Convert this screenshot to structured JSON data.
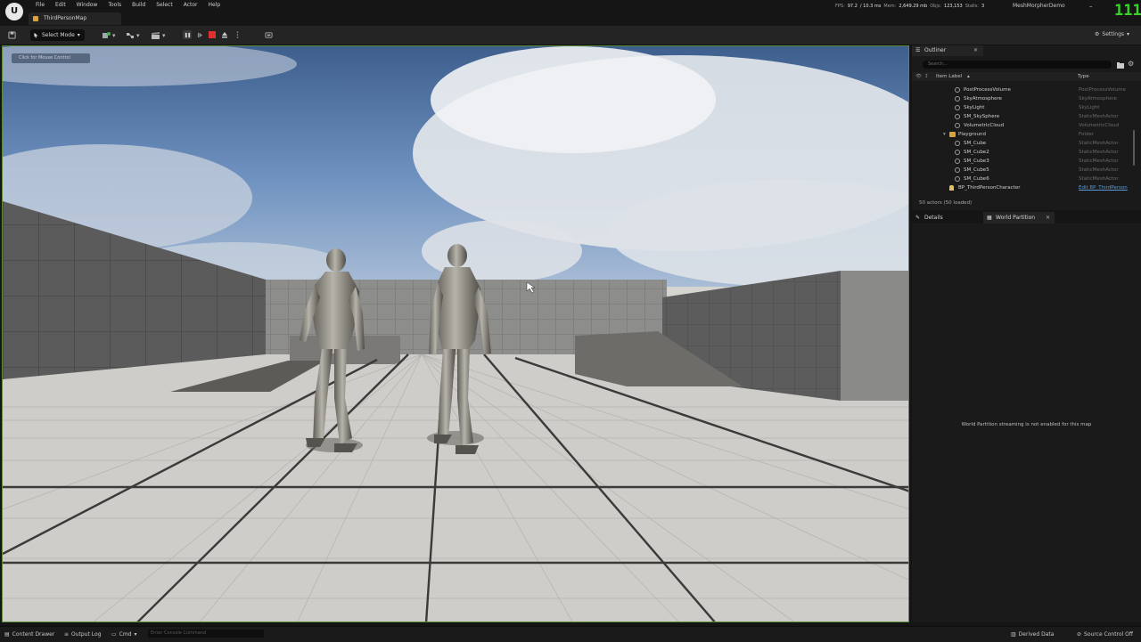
{
  "app": {
    "menu": [
      "File",
      "Edit",
      "Window",
      "Tools",
      "Build",
      "Select",
      "Actor",
      "Help"
    ],
    "map_tab": "ThirdPersonMap",
    "project_name": "MeshMorpherDemo",
    "stats": {
      "fps_label": "FPS:",
      "fps_value": "97.2",
      "frame_ms": "/ 10.3 ms",
      "mem_label": "Mem:",
      "mem_value": "2,649.29 mb",
      "objs_label": "Objs:",
      "objs_value": "123,153",
      "stalls_label": "Stalls:",
      "stalls_value": "3"
    },
    "fps_overlay": "111"
  },
  "toolbar": {
    "select_mode": "Select Mode",
    "settings": "Settings"
  },
  "viewport": {
    "mouse_control_hint": "Click for Mouse Control"
  },
  "outliner": {
    "tab": "Outliner",
    "search_placeholder": "Search...",
    "col_label": "Item Label",
    "col_type": "Type",
    "rows": [
      {
        "label": "PostProcessVolume",
        "type": "PostProcessVolume"
      },
      {
        "label": "SkyAtmosphere",
        "type": "SkyAtmosphere"
      },
      {
        "label": "SkyLight",
        "type": "SkyLight"
      },
      {
        "label": "SM_SkySphere",
        "type": "StaticMeshActor"
      },
      {
        "label": "VolumetricCloud",
        "type": "VolumetricCloud"
      },
      {
        "label": "Playground",
        "type": "Folder"
      },
      {
        "label": "SM_Cube",
        "type": "StaticMeshActor"
      },
      {
        "label": "SM_Cube2",
        "type": "StaticMeshActor"
      },
      {
        "label": "SM_Cube3",
        "type": "StaticMeshActor"
      },
      {
        "label": "SM_Cube5",
        "type": "StaticMeshActor"
      },
      {
        "label": "SM_Cube6",
        "type": "StaticMeshActor"
      },
      {
        "label": "BP_ThirdPersonCharacter",
        "type": "Edit BP_ThirdPerson"
      }
    ],
    "actors_count": "50 actors (50 loaded)"
  },
  "details": {
    "tab_details": "Details",
    "tab_world_partition": "World Partition",
    "message": "World Partition streaming is not enabled for this map"
  },
  "bottombar": {
    "content_drawer": "Content Drawer",
    "output_log": "Output Log",
    "cmd": "Cmd",
    "console_placeholder": "Enter Console Command",
    "derived_data": "Derived Data",
    "source_control": "Source Control Off"
  },
  "colors": {
    "accent_green": "#39d12a",
    "stop_red": "#e03030",
    "selection_blue": "#1f4f7a",
    "folder_yellow": "#d9a23a"
  }
}
